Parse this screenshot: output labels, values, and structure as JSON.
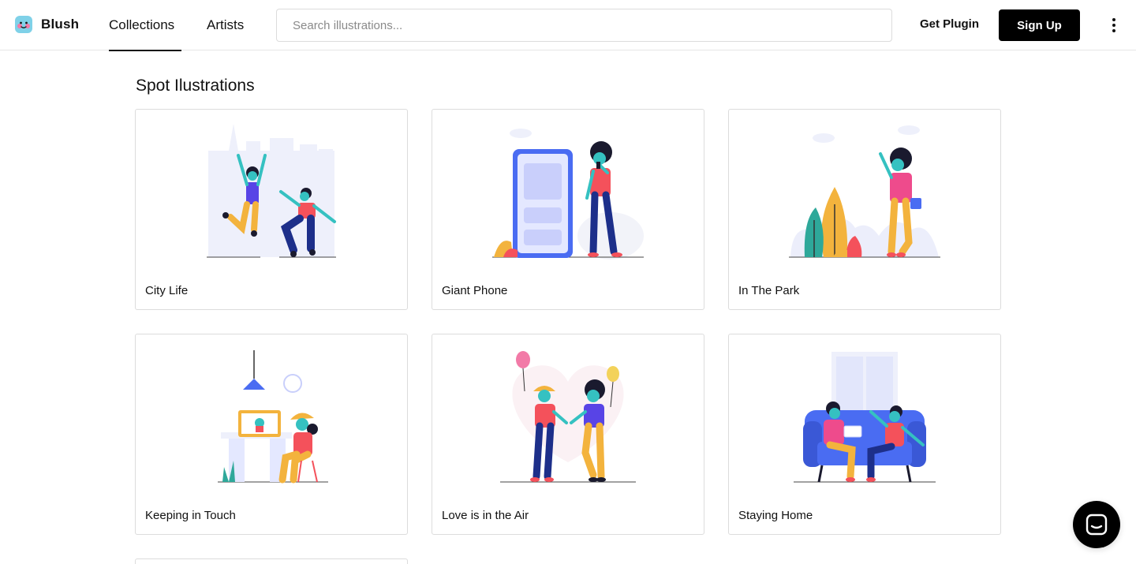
{
  "header": {
    "brand": "Blush",
    "tabs": [
      {
        "label": "Collections",
        "active": true
      },
      {
        "label": "Artists",
        "active": false
      }
    ],
    "search_placeholder": "Search illustrations...",
    "get_plugin_label": "Get Plugin",
    "signup_label": "Sign Up"
  },
  "main": {
    "section_title": "Spot Ilustrations",
    "cards": [
      {
        "title": "City Life"
      },
      {
        "title": "Giant Phone"
      },
      {
        "title": "In The Park"
      },
      {
        "title": "Keeping in Touch"
      },
      {
        "title": "Love is in the Air"
      },
      {
        "title": "Staying Home"
      }
    ]
  },
  "colors": {
    "accent": "#000000",
    "skin": "#35c1c1",
    "blue": "#4a6cf2",
    "red": "#f4515b",
    "yellow": "#f3b33d",
    "pink": "#ee4b8c",
    "navy": "#1d2f8a"
  },
  "icons": [
    "blush-logo-icon",
    "more-vertical-icon",
    "chat-icon"
  ]
}
